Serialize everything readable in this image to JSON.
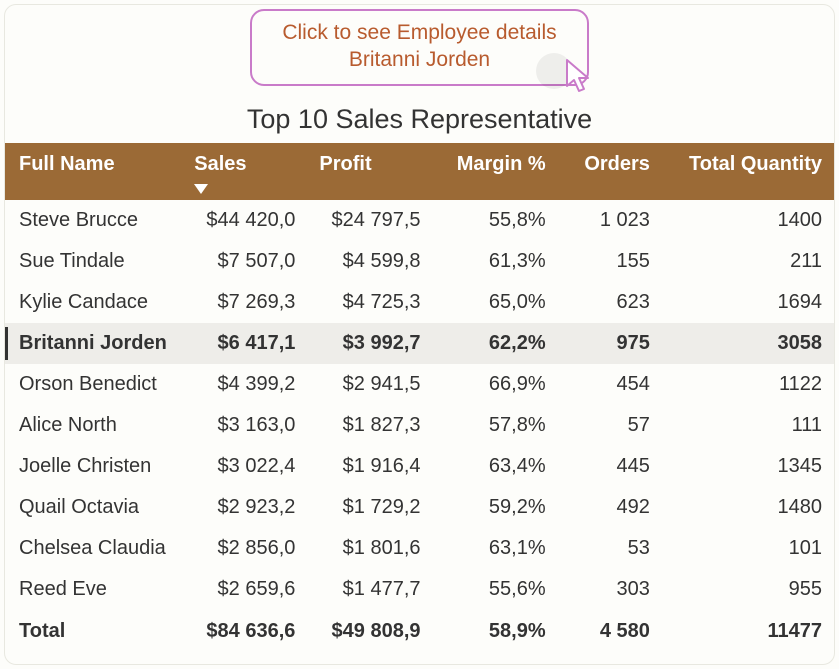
{
  "tooltip": {
    "line1": "Click to see Employee details",
    "line2": "Britanni Jorden"
  },
  "title": "Top 10 Sales Representative",
  "headers": {
    "full_name": "Full Name",
    "sales": "Sales",
    "profit": "Profit",
    "margin": "Margin %",
    "orders": "Orders",
    "total_quantity": "Total Quantity"
  },
  "chart_data": {
    "type": "table",
    "columns": [
      "Full Name",
      "Sales",
      "Profit",
      "Margin %",
      "Orders",
      "Total Quantity"
    ],
    "rows": [
      {
        "name": "Steve Brucce",
        "sales": "$44 420,0",
        "profit": "$24 797,5",
        "margin": "55,8%",
        "orders": "1 023",
        "qty": "1400",
        "highlight": false
      },
      {
        "name": "Sue Tindale",
        "sales": "$7 507,0",
        "profit": "$4 599,8",
        "margin": "61,3%",
        "orders": "155",
        "qty": "211",
        "highlight": false
      },
      {
        "name": "Kylie Candace",
        "sales": "$7 269,3",
        "profit": "$4 725,3",
        "margin": "65,0%",
        "orders": "623",
        "qty": "1694",
        "highlight": false
      },
      {
        "name": "Britanni Jorden",
        "sales": "$6 417,1",
        "profit": "$3 992,7",
        "margin": "62,2%",
        "orders": "975",
        "qty": "3058",
        "highlight": true
      },
      {
        "name": "Orson Benedict",
        "sales": "$4 399,2",
        "profit": "$2 941,5",
        "margin": "66,9%",
        "orders": "454",
        "qty": "1122",
        "highlight": false
      },
      {
        "name": "Alice North",
        "sales": "$3 163,0",
        "profit": "$1 827,3",
        "margin": "57,8%",
        "orders": "57",
        "qty": "111",
        "highlight": false
      },
      {
        "name": "Joelle Christen",
        "sales": "$3 022,4",
        "profit": "$1 916,4",
        "margin": "63,4%",
        "orders": "445",
        "qty": "1345",
        "highlight": false
      },
      {
        "name": "Quail Octavia",
        "sales": "$2 923,2",
        "profit": "$1 729,2",
        "margin": "59,2%",
        "orders": "492",
        "qty": "1480",
        "highlight": false
      },
      {
        "name": "Chelsea Claudia",
        "sales": "$2 856,0",
        "profit": "$1 801,6",
        "margin": "63,1%",
        "orders": "53",
        "qty": "101",
        "highlight": false
      },
      {
        "name": "Reed Eve",
        "sales": "$2 659,6",
        "profit": "$1 477,7",
        "margin": "55,6%",
        "orders": "303",
        "qty": "955",
        "highlight": false
      }
    ],
    "total": {
      "label": "Total",
      "sales": "$84 636,6",
      "profit": "$49 808,9",
      "margin": "58,9%",
      "orders": "4 580",
      "qty": "11477"
    }
  }
}
